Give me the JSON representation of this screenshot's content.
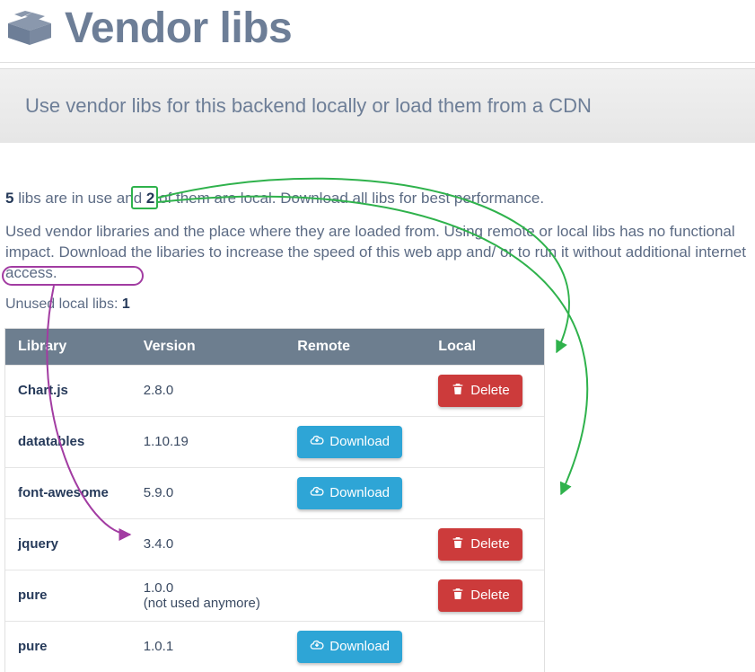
{
  "header": {
    "title": "Vendor libs",
    "icon": "box-icon"
  },
  "banner": {
    "text": "Use vendor libs for this backend locally or load them from a CDN"
  },
  "summary": {
    "libs_count": "5",
    "text_1": " libs are in use and ",
    "local_count": "2",
    "text_2": " of them are local. Download all libs for best performance."
  },
  "description": "Used vendor libraries and the place where they are loaded from. Using remote or local libs has no functional impact. Download the libaries to increase the speed of this web app and/ or to run it without additional internet access.",
  "unused": {
    "label": "Unused local libs: ",
    "count": "1"
  },
  "table": {
    "headers": {
      "library": "Library",
      "version": "Version",
      "remote": "Remote",
      "local": "Local"
    }
  },
  "buttons": {
    "download": "Download",
    "delete": "Delete"
  },
  "rows": [
    {
      "library": "Chart.js",
      "version": "2.8.0",
      "note": "",
      "remote": false,
      "local": true
    },
    {
      "library": "datatables",
      "version": "1.10.19",
      "note": "",
      "remote": true,
      "local": false
    },
    {
      "library": "font-awesome",
      "version": "5.9.0",
      "note": "",
      "remote": true,
      "local": false
    },
    {
      "library": "jquery",
      "version": "3.4.0",
      "note": "",
      "remote": false,
      "local": true
    },
    {
      "library": "pure",
      "version": "1.0.0",
      "note": "(not used anymore)",
      "remote": false,
      "local": true
    },
    {
      "library": "pure",
      "version": "1.0.1",
      "note": "",
      "remote": true,
      "local": false
    }
  ],
  "annotations": {
    "green_box": {
      "target": "local_count"
    },
    "purple_box": {
      "target": "unused_row"
    },
    "arrows": [
      {
        "type": "green",
        "from": "local_count",
        "to": "delete_button_row_0"
      },
      {
        "type": "green",
        "from": "local_count",
        "to": "delete_button_row_3"
      },
      {
        "type": "purple",
        "from": "unused_row",
        "to": "row_4_version"
      }
    ]
  }
}
